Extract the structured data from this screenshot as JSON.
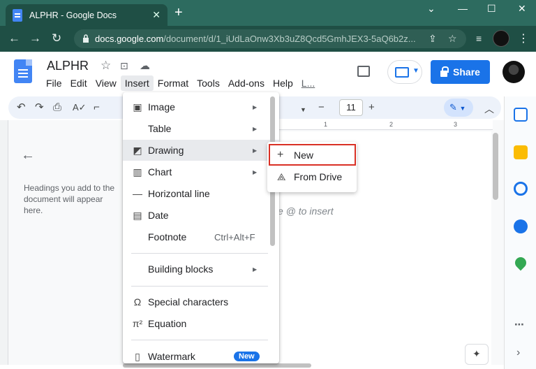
{
  "browser": {
    "tab_title": "ALPHR - Google Docs",
    "tab_close": "✕",
    "new_tab": "+",
    "url_domain": "docs.google.com",
    "url_path": "/document/d/1_iUdLaOnw3Xb3uZ8Qcd5GmhJEX3-5aQ6b2z...",
    "window_controls": [
      "⌄",
      "—",
      "☐",
      "✕"
    ]
  },
  "docs": {
    "title": "ALPHR",
    "menus": [
      "File",
      "Edit",
      "View",
      "Insert",
      "Format",
      "Tools",
      "Add-ons",
      "Help",
      "L..."
    ],
    "share_label": "Share",
    "font_size": "11",
    "outline_hint": "Headings you add to the document will appear here.",
    "insert_hint": "e @ to insert",
    "ruler_marks": [
      "1",
      "2",
      "3"
    ]
  },
  "insert_menu": {
    "items": [
      {
        "label": "Image",
        "icon": "image-icon",
        "glyph": "▣",
        "arrow": true
      },
      {
        "label": "Table",
        "icon": "",
        "glyph": "",
        "arrow": true
      },
      {
        "label": "Drawing",
        "icon": "drawing-icon",
        "glyph": "◩",
        "arrow": true
      },
      {
        "label": "Chart",
        "icon": "chart-icon",
        "glyph": "▥",
        "arrow": true
      },
      {
        "label": "Horizontal line",
        "icon": "horizontal-line-icon",
        "glyph": "—",
        "arrow": false
      },
      {
        "label": "Date",
        "icon": "calendar-icon",
        "glyph": "▤",
        "arrow": false
      },
      {
        "label": "Footnote",
        "icon": "",
        "glyph": "",
        "arrow": false,
        "shortcut": "Ctrl+Alt+F"
      },
      {
        "label": "Building blocks",
        "icon": "",
        "glyph": "",
        "arrow": true
      },
      {
        "label": "Special characters",
        "icon": "omega-icon",
        "glyph": "Ω",
        "arrow": false
      },
      {
        "label": "Equation",
        "icon": "pi-icon",
        "glyph": "π²",
        "arrow": false
      },
      {
        "label": "Watermark",
        "icon": "watermark-icon",
        "glyph": "▯",
        "arrow": false,
        "badge": "New"
      }
    ]
  },
  "drawing_submenu": {
    "new_label": "New",
    "from_drive_label": "From Drive"
  },
  "colors": {
    "accent": "#1a73e8",
    "highlight_box": "#d93025",
    "browser_frame": "#2d6b5f"
  }
}
